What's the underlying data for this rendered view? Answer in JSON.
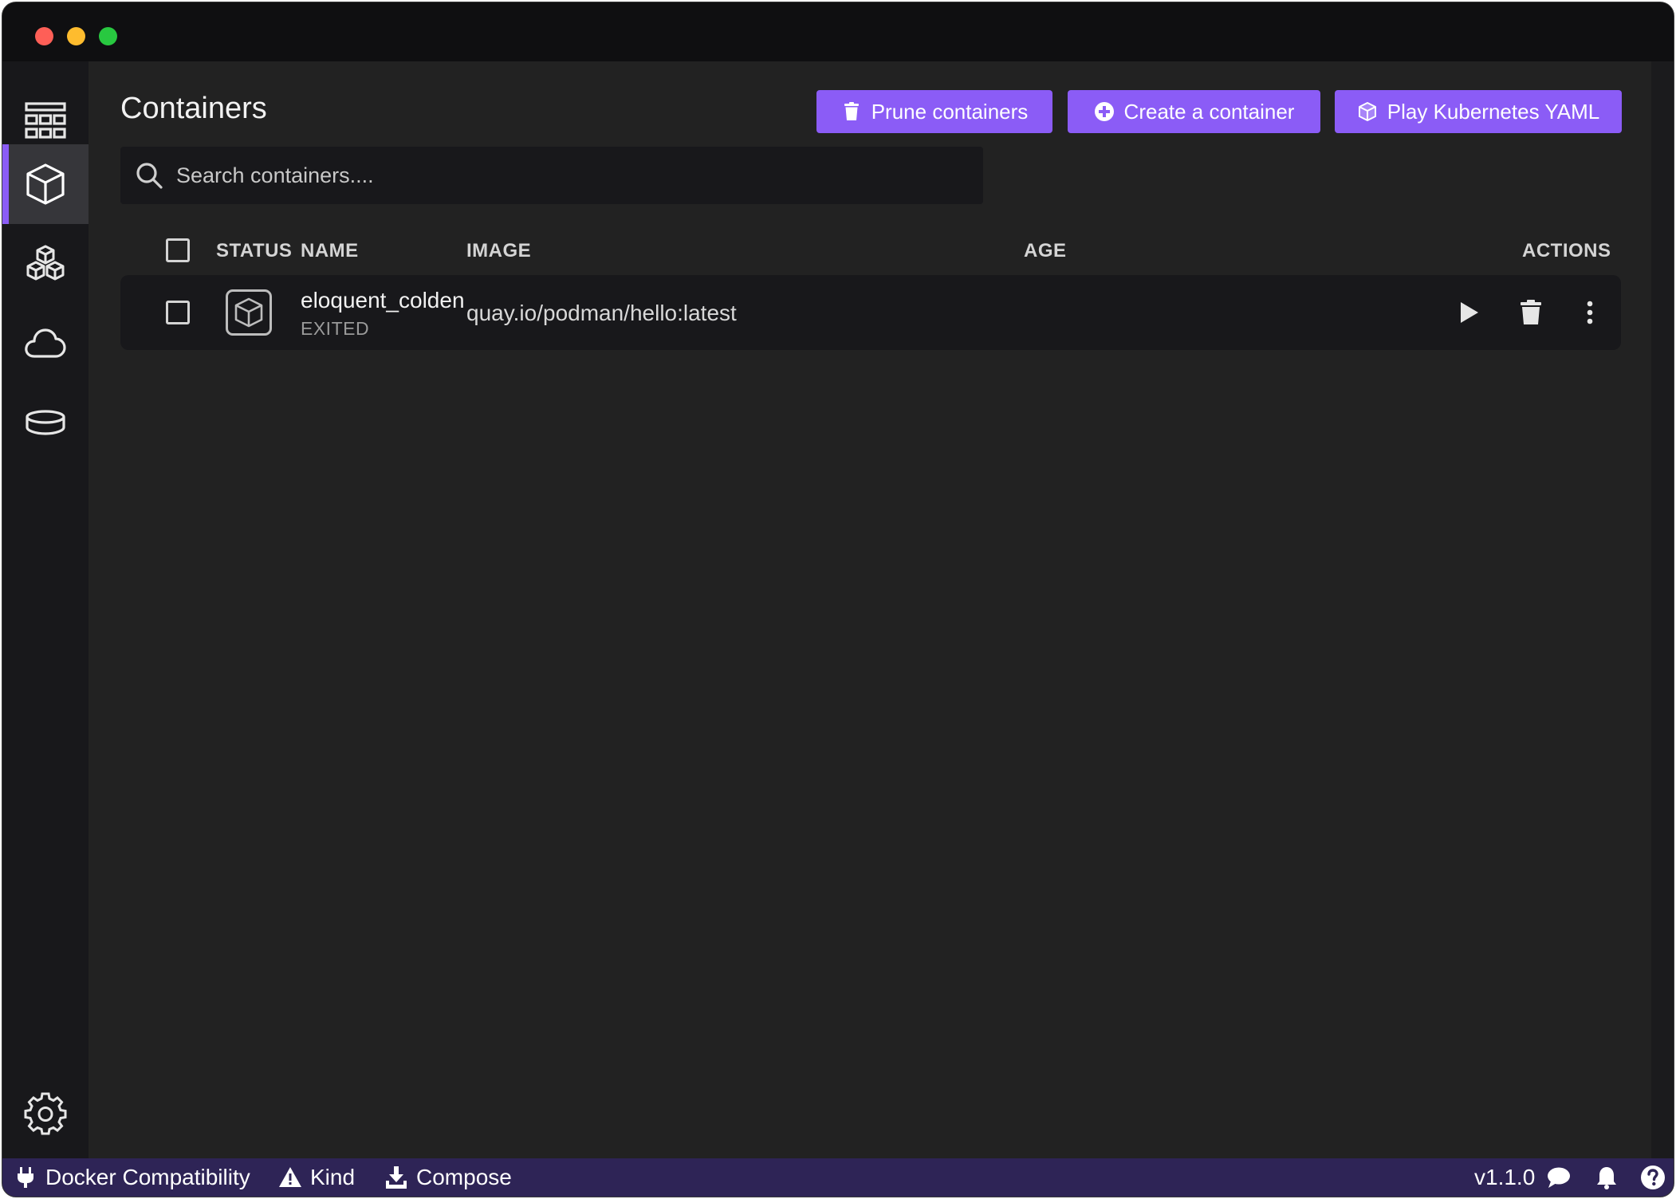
{
  "app": {
    "title": "Containers",
    "accent_color": "#8b5cf6",
    "statusbar_color": "#2e2456"
  },
  "sidebar": {
    "items": [
      {
        "name": "dashboard",
        "icon": "dashboard-grid-icon",
        "active": false
      },
      {
        "name": "containers",
        "icon": "container-cube-icon",
        "active": true
      },
      {
        "name": "pods",
        "icon": "pods-cubes-icon",
        "active": false
      },
      {
        "name": "images",
        "icon": "cloud-icon",
        "active": false
      },
      {
        "name": "volumes",
        "icon": "volume-disk-icon",
        "active": false
      }
    ],
    "settings_icon": "gear-icon"
  },
  "toolbar": {
    "prune_label": "Prune containers",
    "create_label": "Create a container",
    "play_label": "Play Kubernetes YAML"
  },
  "search": {
    "placeholder": "Search containers....",
    "value": ""
  },
  "table": {
    "headers": {
      "status": "STATUS",
      "name": "NAME",
      "image": "IMAGE",
      "age": "AGE",
      "actions": "ACTIONS"
    },
    "rows": [
      {
        "name": "eloquent_colden",
        "status": "EXITED",
        "image": "quay.io/podman/hello:latest",
        "age": ""
      }
    ]
  },
  "statusbar": {
    "docker_compat": "Docker Compatibility",
    "kind": "Kind",
    "compose": "Compose",
    "version": "v1.1.0"
  }
}
